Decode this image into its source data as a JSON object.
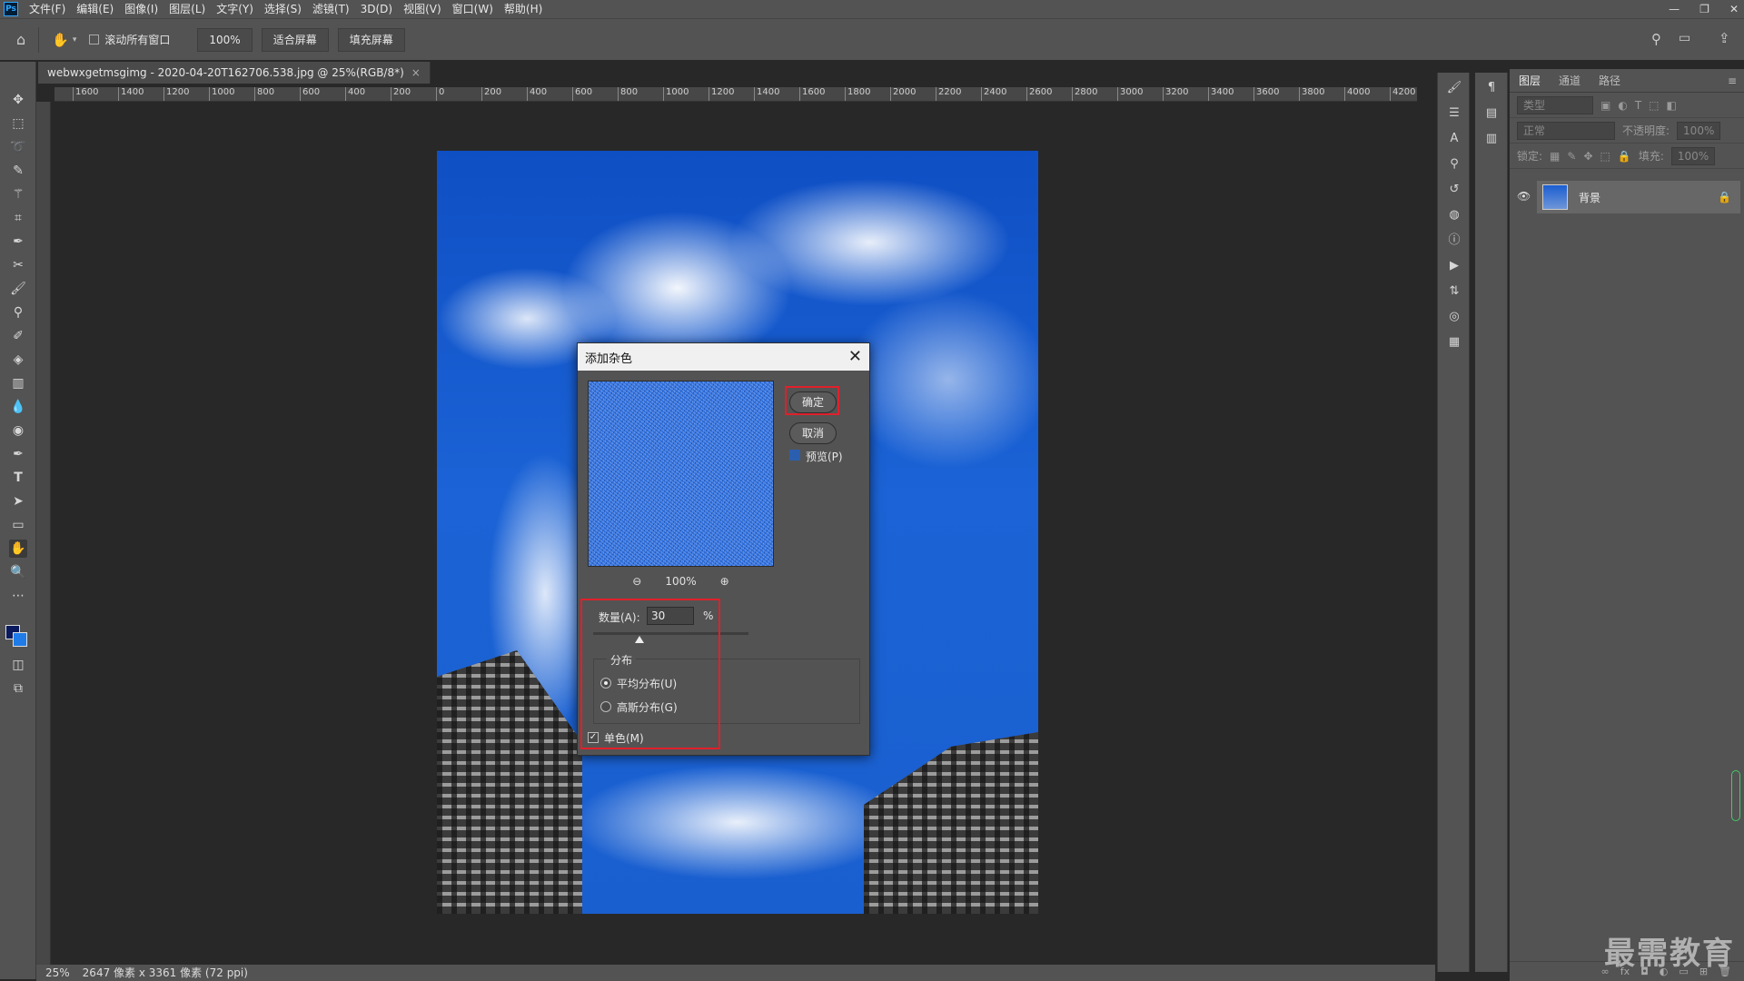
{
  "menubar": {
    "logo": "Ps",
    "items": [
      "文件(F)",
      "编辑(E)",
      "图像(I)",
      "图层(L)",
      "文字(Y)",
      "选择(S)",
      "滤镜(T)",
      "3D(D)",
      "视图(V)",
      "窗口(W)",
      "帮助(H)"
    ]
  },
  "options": {
    "scroll_all_label": "滚动所有窗口",
    "zoom_value": "100%",
    "fit_screen": "适合屏幕",
    "fill_screen": "填充屏幕"
  },
  "document": {
    "tab_title": "webwxgetmsgimg - 2020-04-20T162706.538.jpg @ 25%(RGB/8*)",
    "close": "×"
  },
  "ruler": {
    "h_ticks": [
      "1600",
      "1400",
      "1200",
      "1000",
      "800",
      "600",
      "400",
      "200",
      "0",
      "200",
      "400",
      "600",
      "800",
      "1000",
      "1200",
      "1400",
      "1600",
      "1800",
      "2000",
      "2200",
      "2400",
      "2600",
      "2800",
      "3000",
      "3200",
      "3400",
      "3600",
      "3800",
      "4000",
      "4200"
    ]
  },
  "layers_panel": {
    "tabs": [
      "图层",
      "通道",
      "路径"
    ],
    "filter_placeholder": "类型",
    "blend_mode": "正常",
    "opacity_label": "不透明度:",
    "opacity_value": "100%",
    "lock_label": "锁定:",
    "fill_label": "填充:",
    "fill_value": "100%",
    "layer_name": "背景"
  },
  "dialog": {
    "title": "添加杂色",
    "ok": "确定",
    "cancel": "取消",
    "preview_label": "预览(P)",
    "zoom": "100%",
    "amount_label": "数量(A):",
    "amount_value": "30",
    "amount_unit": "%",
    "amount_slider_fraction": 0.3,
    "distribution_label": "分布",
    "uniform_label": "平均分布(U)",
    "gaussian_label": "高斯分布(G)",
    "mono_label": "单色(M)",
    "uniform_selected": true,
    "mono_checked": true,
    "preview_checked": false
  },
  "status": {
    "zoom": "25%",
    "doc_info": "2647 像素 x 3361 像素 (72 ppi)"
  },
  "watermark": "最需教育",
  "colors": {
    "highlight": "#e0202b",
    "panel": "#535353",
    "workspace": "#282828"
  }
}
